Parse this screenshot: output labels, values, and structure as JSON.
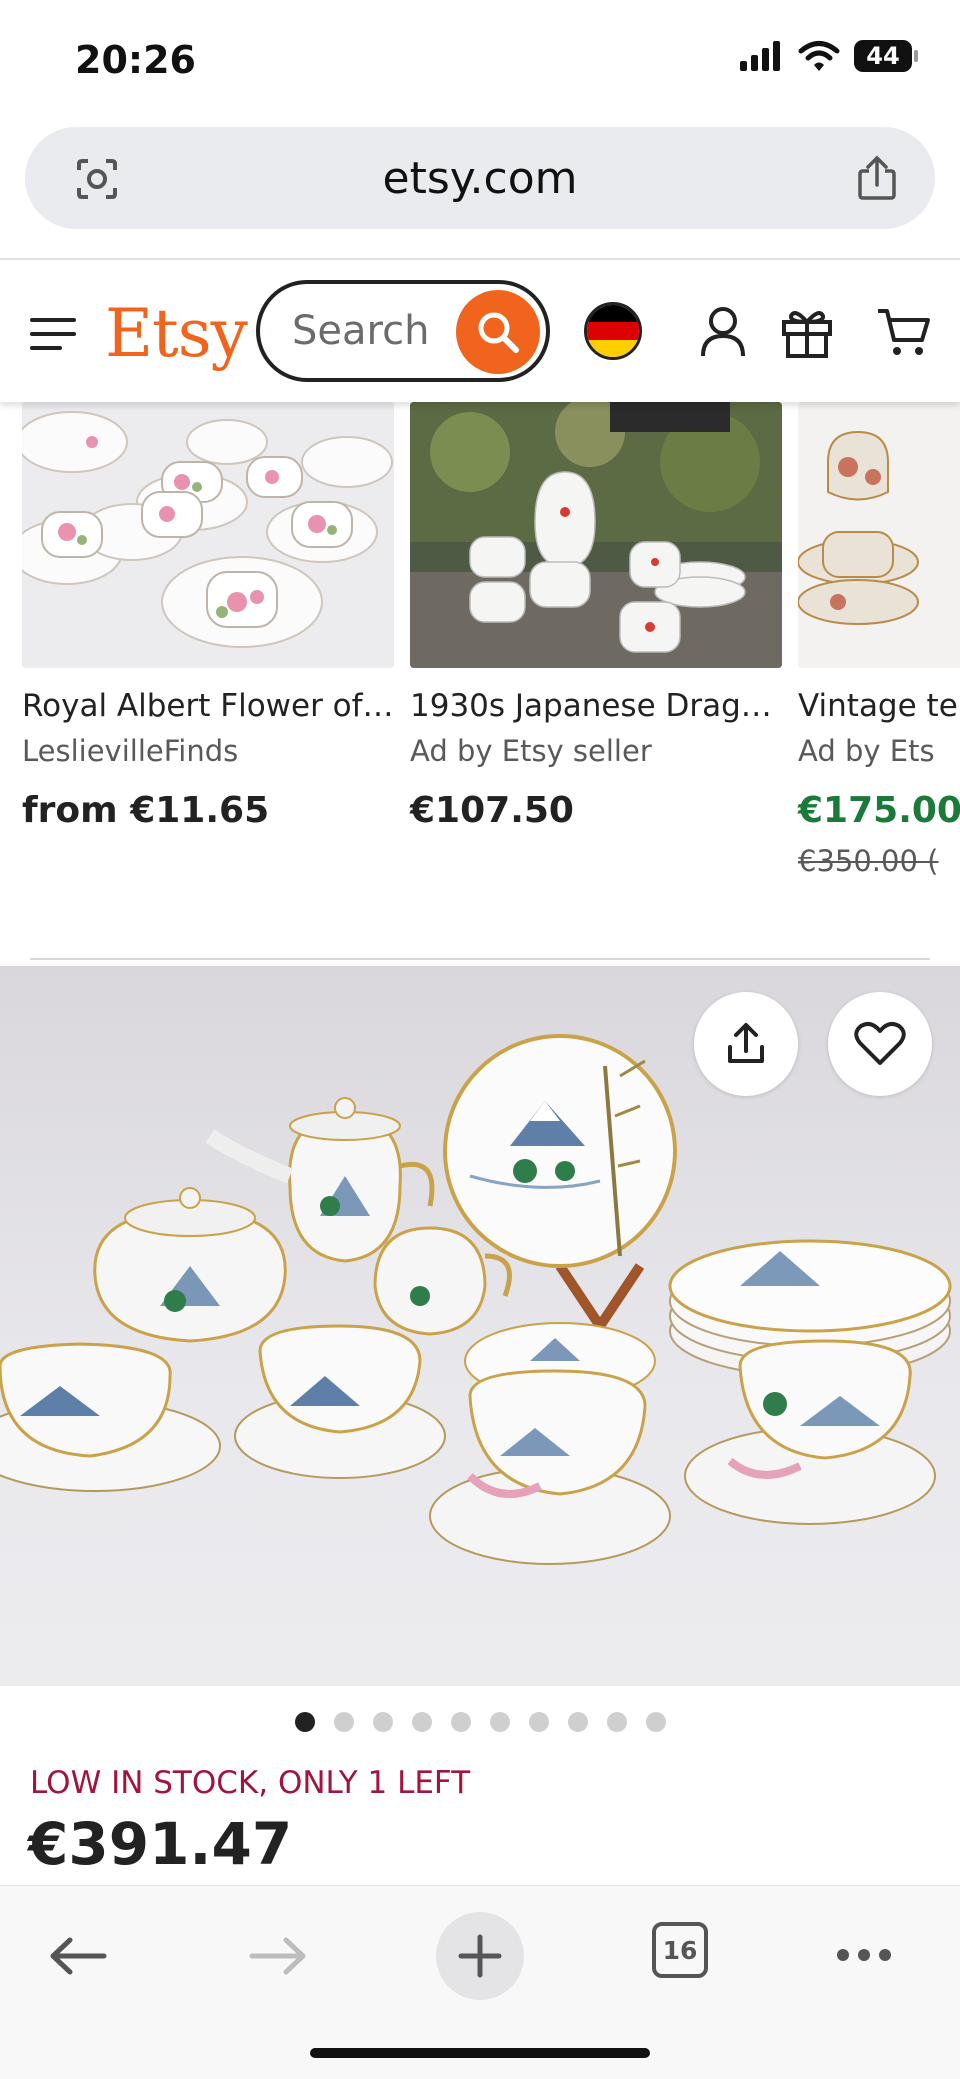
{
  "status_bar": {
    "time": "20:26",
    "battery": "44"
  },
  "browser": {
    "url": "etsy.com",
    "tab_count": "16"
  },
  "header": {
    "logo": "Etsy",
    "search_placeholder": "Search"
  },
  "recommendations": [
    {
      "title": "Royal Albert Flower of…",
      "seller": "LeslievilleFinds",
      "price": "from €11.65"
    },
    {
      "title": "1930s Japanese Drag…",
      "seller": "Ad by Etsy seller",
      "price": "€107.50"
    },
    {
      "title": "Vintage te",
      "seller": "Ad by Ets",
      "price": "€175.00",
      "original_price": "€350.00 ("
    }
  ],
  "listing": {
    "image_count": 10,
    "active_image_index": 0,
    "stock_notice": "LOW IN STOCK, ONLY 1 LEFT",
    "price": "€391.47"
  },
  "colors": {
    "brand": "#f1641e",
    "stock_alert": "#a0153e",
    "sale_price": "#1b7a3a"
  }
}
